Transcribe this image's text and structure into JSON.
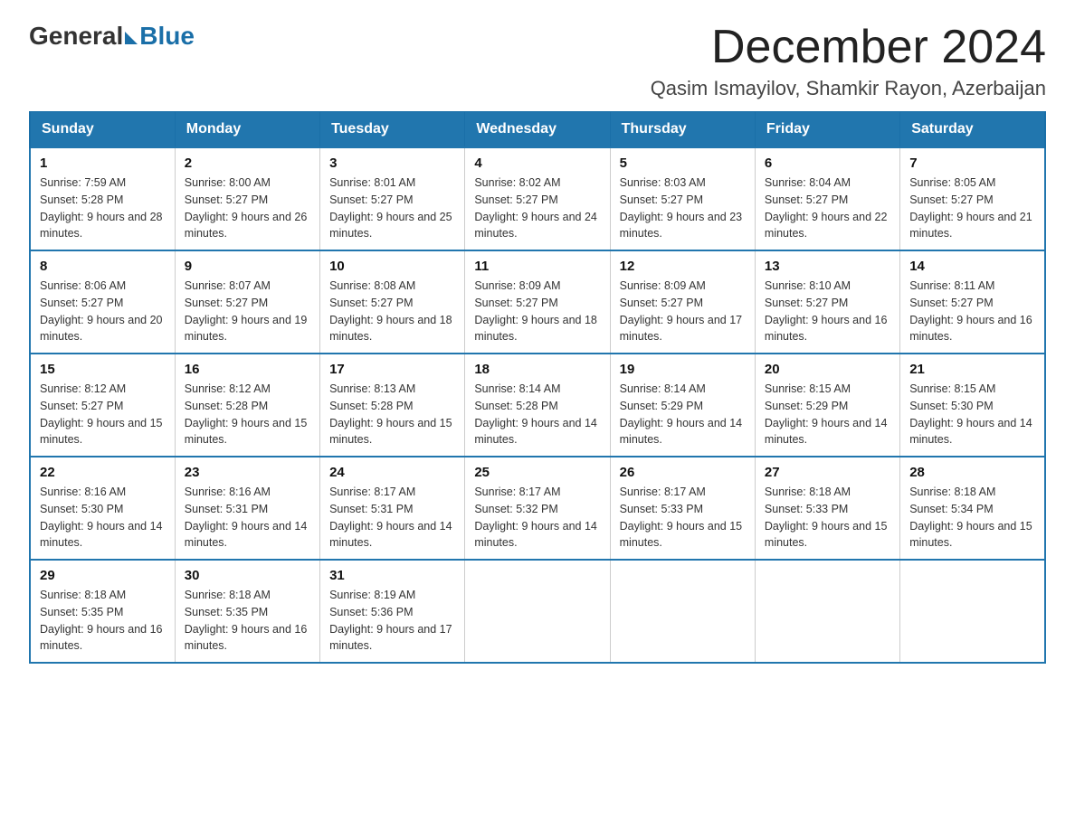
{
  "header": {
    "logo_general": "General",
    "logo_blue": "Blue",
    "month_title": "December 2024",
    "location": "Qasim Ismayilov, Shamkir Rayon, Azerbaijan"
  },
  "weekdays": [
    "Sunday",
    "Monday",
    "Tuesday",
    "Wednesday",
    "Thursday",
    "Friday",
    "Saturday"
  ],
  "weeks": [
    [
      {
        "day": "1",
        "sunrise": "Sunrise: 7:59 AM",
        "sunset": "Sunset: 5:28 PM",
        "daylight": "Daylight: 9 hours and 28 minutes."
      },
      {
        "day": "2",
        "sunrise": "Sunrise: 8:00 AM",
        "sunset": "Sunset: 5:27 PM",
        "daylight": "Daylight: 9 hours and 26 minutes."
      },
      {
        "day": "3",
        "sunrise": "Sunrise: 8:01 AM",
        "sunset": "Sunset: 5:27 PM",
        "daylight": "Daylight: 9 hours and 25 minutes."
      },
      {
        "day": "4",
        "sunrise": "Sunrise: 8:02 AM",
        "sunset": "Sunset: 5:27 PM",
        "daylight": "Daylight: 9 hours and 24 minutes."
      },
      {
        "day": "5",
        "sunrise": "Sunrise: 8:03 AM",
        "sunset": "Sunset: 5:27 PM",
        "daylight": "Daylight: 9 hours and 23 minutes."
      },
      {
        "day": "6",
        "sunrise": "Sunrise: 8:04 AM",
        "sunset": "Sunset: 5:27 PM",
        "daylight": "Daylight: 9 hours and 22 minutes."
      },
      {
        "day": "7",
        "sunrise": "Sunrise: 8:05 AM",
        "sunset": "Sunset: 5:27 PM",
        "daylight": "Daylight: 9 hours and 21 minutes."
      }
    ],
    [
      {
        "day": "8",
        "sunrise": "Sunrise: 8:06 AM",
        "sunset": "Sunset: 5:27 PM",
        "daylight": "Daylight: 9 hours and 20 minutes."
      },
      {
        "day": "9",
        "sunrise": "Sunrise: 8:07 AM",
        "sunset": "Sunset: 5:27 PM",
        "daylight": "Daylight: 9 hours and 19 minutes."
      },
      {
        "day": "10",
        "sunrise": "Sunrise: 8:08 AM",
        "sunset": "Sunset: 5:27 PM",
        "daylight": "Daylight: 9 hours and 18 minutes."
      },
      {
        "day": "11",
        "sunrise": "Sunrise: 8:09 AM",
        "sunset": "Sunset: 5:27 PM",
        "daylight": "Daylight: 9 hours and 18 minutes."
      },
      {
        "day": "12",
        "sunrise": "Sunrise: 8:09 AM",
        "sunset": "Sunset: 5:27 PM",
        "daylight": "Daylight: 9 hours and 17 minutes."
      },
      {
        "day": "13",
        "sunrise": "Sunrise: 8:10 AM",
        "sunset": "Sunset: 5:27 PM",
        "daylight": "Daylight: 9 hours and 16 minutes."
      },
      {
        "day": "14",
        "sunrise": "Sunrise: 8:11 AM",
        "sunset": "Sunset: 5:27 PM",
        "daylight": "Daylight: 9 hours and 16 minutes."
      }
    ],
    [
      {
        "day": "15",
        "sunrise": "Sunrise: 8:12 AM",
        "sunset": "Sunset: 5:27 PM",
        "daylight": "Daylight: 9 hours and 15 minutes."
      },
      {
        "day": "16",
        "sunrise": "Sunrise: 8:12 AM",
        "sunset": "Sunset: 5:28 PM",
        "daylight": "Daylight: 9 hours and 15 minutes."
      },
      {
        "day": "17",
        "sunrise": "Sunrise: 8:13 AM",
        "sunset": "Sunset: 5:28 PM",
        "daylight": "Daylight: 9 hours and 15 minutes."
      },
      {
        "day": "18",
        "sunrise": "Sunrise: 8:14 AM",
        "sunset": "Sunset: 5:28 PM",
        "daylight": "Daylight: 9 hours and 14 minutes."
      },
      {
        "day": "19",
        "sunrise": "Sunrise: 8:14 AM",
        "sunset": "Sunset: 5:29 PM",
        "daylight": "Daylight: 9 hours and 14 minutes."
      },
      {
        "day": "20",
        "sunrise": "Sunrise: 8:15 AM",
        "sunset": "Sunset: 5:29 PM",
        "daylight": "Daylight: 9 hours and 14 minutes."
      },
      {
        "day": "21",
        "sunrise": "Sunrise: 8:15 AM",
        "sunset": "Sunset: 5:30 PM",
        "daylight": "Daylight: 9 hours and 14 minutes."
      }
    ],
    [
      {
        "day": "22",
        "sunrise": "Sunrise: 8:16 AM",
        "sunset": "Sunset: 5:30 PM",
        "daylight": "Daylight: 9 hours and 14 minutes."
      },
      {
        "day": "23",
        "sunrise": "Sunrise: 8:16 AM",
        "sunset": "Sunset: 5:31 PM",
        "daylight": "Daylight: 9 hours and 14 minutes."
      },
      {
        "day": "24",
        "sunrise": "Sunrise: 8:17 AM",
        "sunset": "Sunset: 5:31 PM",
        "daylight": "Daylight: 9 hours and 14 minutes."
      },
      {
        "day": "25",
        "sunrise": "Sunrise: 8:17 AM",
        "sunset": "Sunset: 5:32 PM",
        "daylight": "Daylight: 9 hours and 14 minutes."
      },
      {
        "day": "26",
        "sunrise": "Sunrise: 8:17 AM",
        "sunset": "Sunset: 5:33 PM",
        "daylight": "Daylight: 9 hours and 15 minutes."
      },
      {
        "day": "27",
        "sunrise": "Sunrise: 8:18 AM",
        "sunset": "Sunset: 5:33 PM",
        "daylight": "Daylight: 9 hours and 15 minutes."
      },
      {
        "day": "28",
        "sunrise": "Sunrise: 8:18 AM",
        "sunset": "Sunset: 5:34 PM",
        "daylight": "Daylight: 9 hours and 15 minutes."
      }
    ],
    [
      {
        "day": "29",
        "sunrise": "Sunrise: 8:18 AM",
        "sunset": "Sunset: 5:35 PM",
        "daylight": "Daylight: 9 hours and 16 minutes."
      },
      {
        "day": "30",
        "sunrise": "Sunrise: 8:18 AM",
        "sunset": "Sunset: 5:35 PM",
        "daylight": "Daylight: 9 hours and 16 minutes."
      },
      {
        "day": "31",
        "sunrise": "Sunrise: 8:19 AM",
        "sunset": "Sunset: 5:36 PM",
        "daylight": "Daylight: 9 hours and 17 minutes."
      },
      null,
      null,
      null,
      null
    ]
  ]
}
